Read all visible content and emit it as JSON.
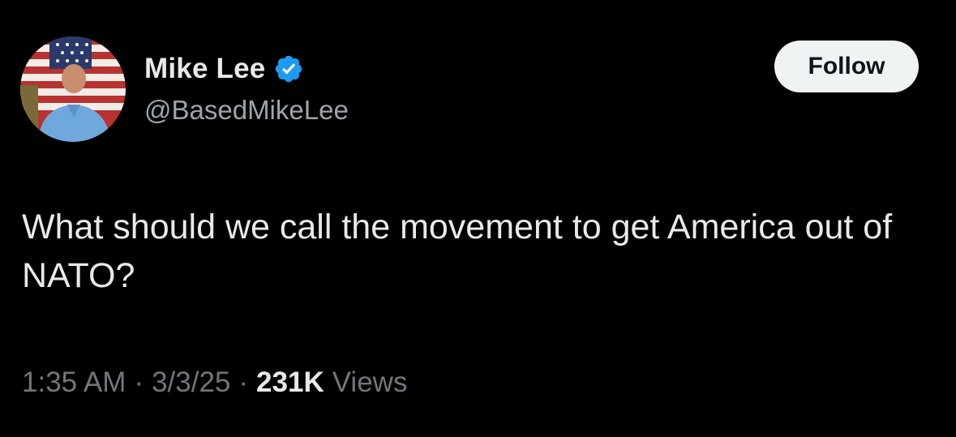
{
  "author": {
    "display_name": "Mike Lee",
    "handle": "@BasedMikeLee",
    "verified_icon": "verified-badge-icon",
    "verified_color": "#1d9bf0"
  },
  "follow_button": {
    "label": "Follow"
  },
  "tweet": {
    "text": "What should we call the movement to get America out of NATO?"
  },
  "meta": {
    "time": "1:35 AM",
    "separator": "·",
    "date": "3/3/25",
    "views_count": "231K",
    "views_label": "Views"
  },
  "colors": {
    "background": "#000000",
    "primary_text": "#e7e9ea",
    "secondary_text": "#71767b",
    "button_bg": "#eff3f4"
  }
}
